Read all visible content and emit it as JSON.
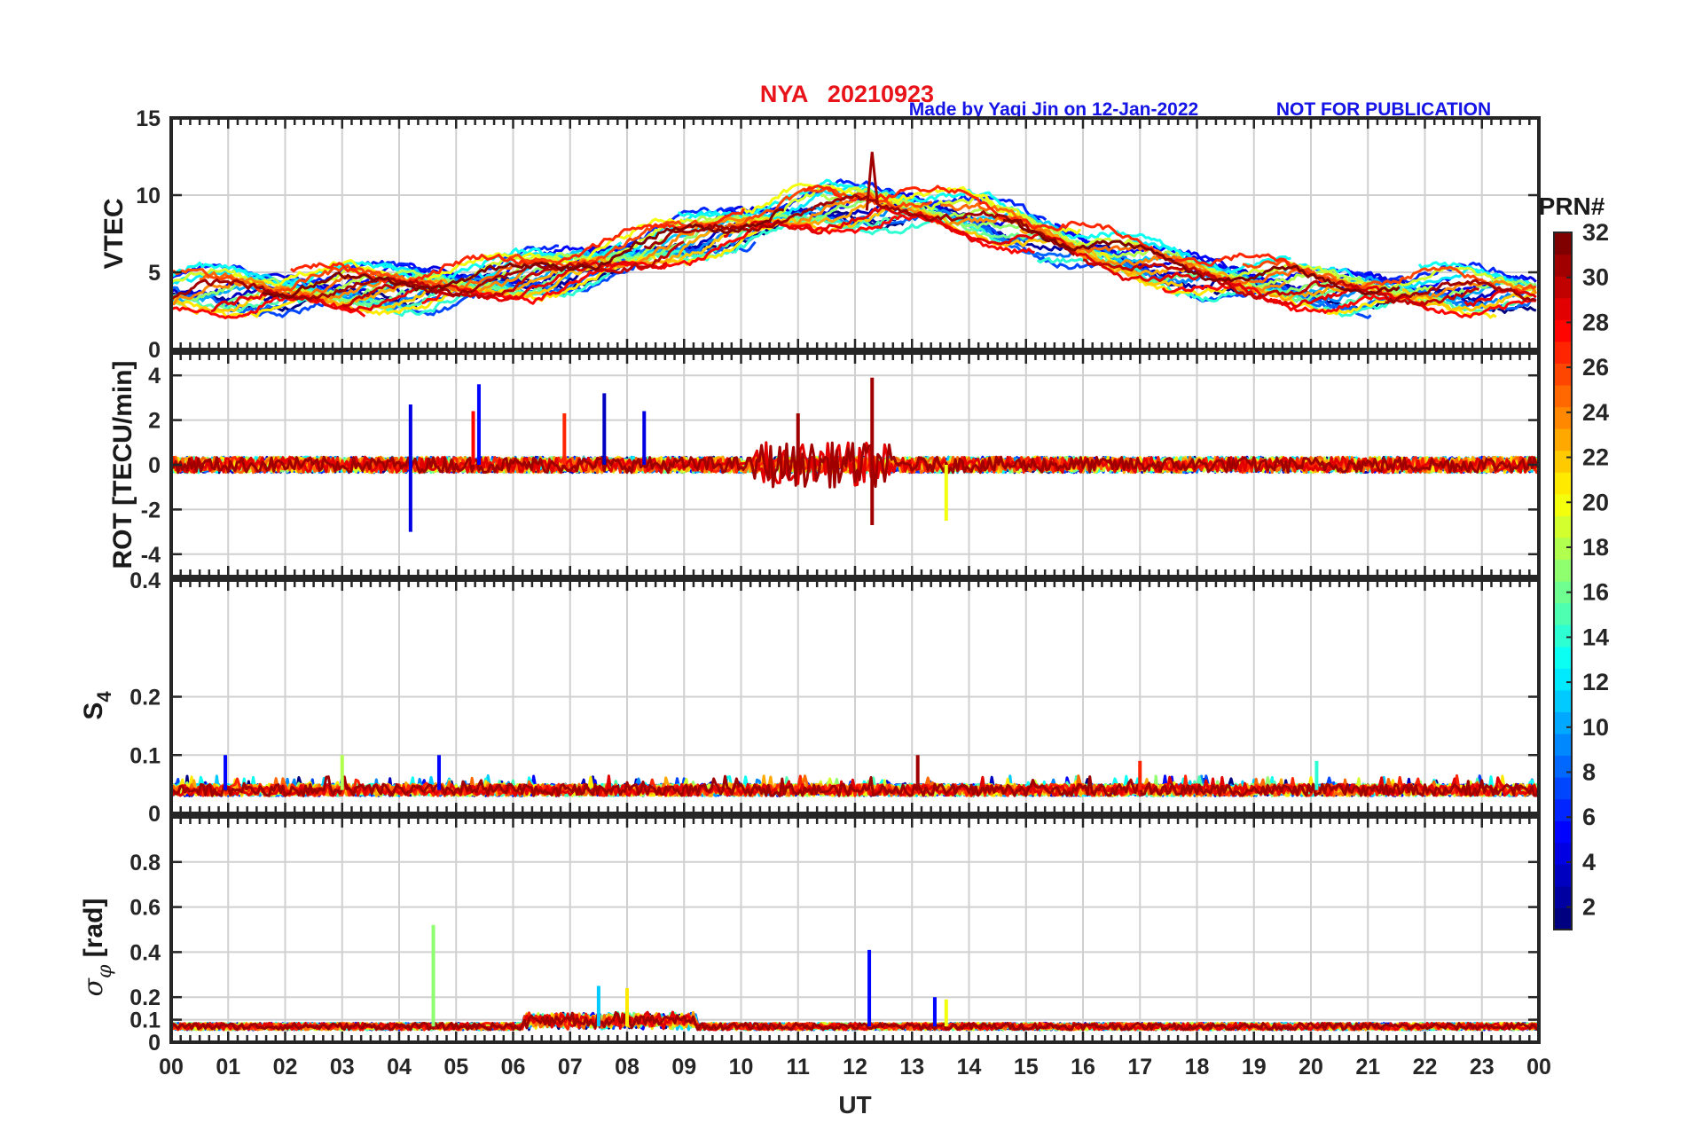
{
  "header": {
    "title": "NYA   20210923",
    "made_by": "Made by Yaqi Jin on 12-Jan-2022",
    "notice": "NOT FOR PUBLICATION",
    "title_color": "#e8141a",
    "notice_color": "#1414e6"
  },
  "colorbar": {
    "label": "PRN#",
    "ticks": [
      "2",
      "4",
      "6",
      "8",
      "10",
      "12",
      "14",
      "16",
      "18",
      "20",
      "22",
      "24",
      "26",
      "28",
      "30",
      "32"
    ],
    "range": [
      1,
      32
    ],
    "colormap": "jet"
  },
  "chart_data": [
    {
      "type": "line",
      "panel": "vtec",
      "ylabel": "VTEC",
      "ylim": [
        0,
        15
      ],
      "yticks": [
        "0",
        "5",
        "10",
        "15"
      ],
      "xlim": [
        0,
        24
      ],
      "grid": true,
      "series_summary": "per-PRN VTEC traces, approx. 3-5 TECU at night, peaking ~9-12 TECU near 12-13 UT",
      "peak_value": 12.8,
      "peak_time_ut": 12.3
    },
    {
      "type": "line",
      "panel": "rot",
      "ylabel": "ROT [TECU/min]",
      "ylim": [
        -5,
        5
      ],
      "yticks": [
        "-4",
        "-2",
        "0",
        "2",
        "4"
      ],
      "xlim": [
        0,
        24
      ],
      "grid": true,
      "spikes": [
        {
          "x": 4.2,
          "y": 2.7,
          "prn": 4
        },
        {
          "x": 4.2,
          "y": -3.0,
          "prn": 4
        },
        {
          "x": 5.4,
          "y": 3.6,
          "prn": 5
        },
        {
          "x": 5.3,
          "y": 2.4,
          "prn": 28
        },
        {
          "x": 7.6,
          "y": 3.2,
          "prn": 3
        },
        {
          "x": 8.3,
          "y": 2.4,
          "prn": 4
        },
        {
          "x": 6.9,
          "y": 2.3,
          "prn": 27
        },
        {
          "x": 12.3,
          "y": 3.9,
          "prn": 31
        },
        {
          "x": 12.3,
          "y": -2.7,
          "prn": 31
        },
        {
          "x": 11.0,
          "y": 2.3,
          "prn": 31
        },
        {
          "x": 13.6,
          "y": -2.5,
          "prn": 20
        }
      ]
    },
    {
      "type": "line",
      "panel": "s4",
      "ylabel": "S4",
      "ylim": [
        0,
        0.4
      ],
      "yticks": [
        "0",
        "0.1",
        "0.2",
        "0.4"
      ],
      "xlim": [
        0,
        24
      ],
      "grid": true,
      "baseline": 0.04,
      "spikes": [
        {
          "x": 0.95,
          "y": 0.1,
          "prn": 5
        },
        {
          "x": 4.7,
          "y": 0.1,
          "prn": 5
        },
        {
          "x": 3.0,
          "y": 0.1,
          "prn": 18
        },
        {
          "x": 13.1,
          "y": 0.1,
          "prn": 31
        },
        {
          "x": 17.0,
          "y": 0.09,
          "prn": 27
        },
        {
          "x": 20.1,
          "y": 0.09,
          "prn": 14
        }
      ]
    },
    {
      "type": "line",
      "panel": "sigma_phi",
      "ylabel": "σ_φ [rad]",
      "ylim": [
        0,
        1
      ],
      "yticks": [
        "0",
        "0.1",
        "0.2",
        "0.4",
        "0.6",
        "0.8"
      ],
      "xlim": [
        0,
        24
      ],
      "xlabel": "UT",
      "xticks": [
        "00",
        "01",
        "02",
        "03",
        "04",
        "05",
        "06",
        "07",
        "08",
        "09",
        "10",
        "11",
        "12",
        "13",
        "14",
        "15",
        "16",
        "17",
        "18",
        "19",
        "20",
        "21",
        "22",
        "23",
        "00"
      ],
      "grid": true,
      "baseline": 0.07,
      "spikes": [
        {
          "x": 4.6,
          "y": 0.52,
          "prn": 17
        },
        {
          "x": 12.25,
          "y": 0.41,
          "prn": 5
        },
        {
          "x": 7.5,
          "y": 0.25,
          "prn": 11
        },
        {
          "x": 8.0,
          "y": 0.24,
          "prn": 21
        },
        {
          "x": 13.4,
          "y": 0.2,
          "prn": 5
        },
        {
          "x": 13.6,
          "y": 0.19,
          "prn": 20
        }
      ]
    }
  ]
}
